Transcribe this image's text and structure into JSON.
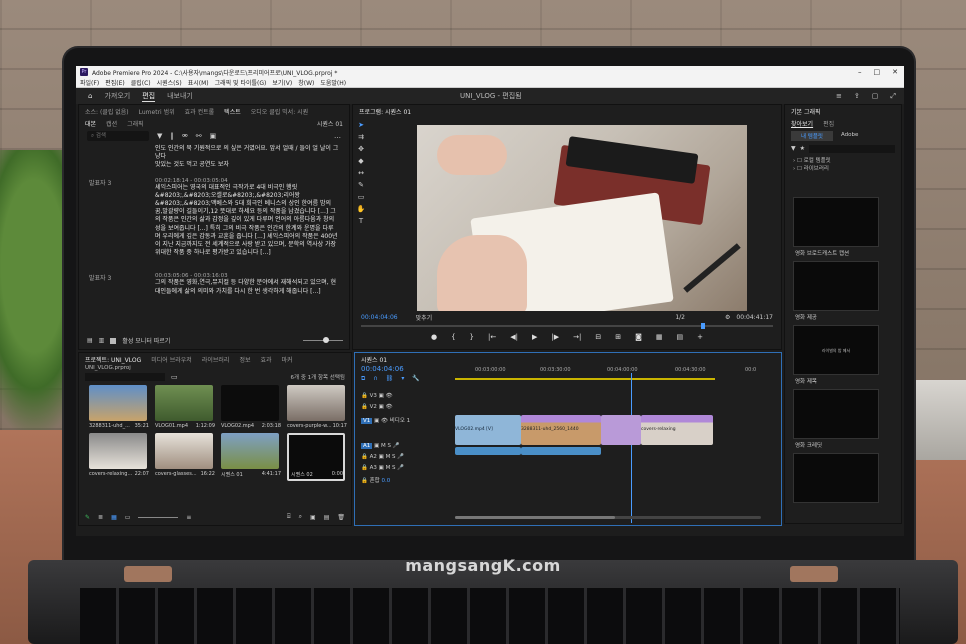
{
  "watermark": "mangsangK.com",
  "app": {
    "title": "Adobe Premiere Pro 2024 - C:\\사용자\\mangs\\다운로드\\프리미어프로\\UNI_VLOG.prproj *",
    "menu": [
      "파일(F)",
      "편집(E)",
      "클립(C)",
      "시퀀스(S)",
      "표시(M)",
      "그래픽 및 타이틀(G)",
      "보기(V)",
      "창(W)",
      "도움말(H)"
    ],
    "workspace_tabs": [
      "가져오기",
      "편집",
      "내보내기"
    ],
    "active_workspace": "편집",
    "project_name": "UNI_VLOG - 편집됨"
  },
  "text_panel": {
    "tabs": [
      "소스: (클립 없음)",
      "Lumetri 범위",
      "효과 컨트롤",
      "텍스트",
      "오디오 클립 믹서: 시퀀"
    ],
    "subtabs": [
      "대본",
      "캡션",
      "그래픽"
    ],
    "sequence": "시퀀스 01",
    "search_placeholder": "검색",
    "top_line1": "인도 인간의 북 기원적으로 의 싶은 거였어요. 앞서 얼때 / 들이 얼 날이 그냥다",
    "top_line2": "맛있는 것도 먹고 공연도 보자",
    "entries": [
      {
        "speaker": "발표자 3",
        "time": "00:02:18:14 - 00:03:05:04",
        "text": "셰익스피어는 영국의 대표적인 극작가로 4대 비극인 햄릿&#8203;,&#8203;오셀로&#8203;,&#8203;리어왕&#8203;,&#8203;맥베스와 5대 희극인 베니스의 상인 한여름 밤의 꿈,말괄량이 길들이기,12 뜻대로 하세요 등의 작품을 남겼습니다 [...] 그의 작품은 인간의 삶과 감정을 깊이 있게 다루며 언어의 아름다움과 창의성을 보여줍니다 [...] 특히 그의 비극 작품은 인간의 한계와 운명을 다루며 우리에게 깊은 감동과 교훈을 줍니다 [...] 셰익스피어의 작품은 400년이 지난 지금까지도 전 세계적으로 사랑 받고 있으며, 문학의 역사상 가장 위대한 작품 중 하나로 평가받고 있습니다 [...]"
      },
      {
        "speaker": "발표자 3",
        "time": "00:03:05:06 - 00:03:16:03",
        "text": "그의 작품은 영화,연극,뮤지컬 등 다양한 분야에서 재해석되고 있으며, 현대인들에게 삶의 의미와 가치를 다시 한 번 생각하게 해줍니다 [...]"
      }
    ],
    "monitor_label": "활성 모니터 따르기"
  },
  "program": {
    "tab": "프로그램: 시퀀스 01",
    "timecode_left": "00:04:04:06",
    "fit": "맞추기",
    "quality": "1/2",
    "timecode_right": "00:04:41:17"
  },
  "project": {
    "tabs": [
      "프로젝트: UNI_VLOG",
      "미디어 브라우저",
      "라이브러리",
      "정보",
      "효과",
      "마커"
    ],
    "file": "UNI_VLOG.prproj",
    "count": "6개 중 1개 항목 선택됨",
    "items": [
      {
        "name": "3288311-uhd_...",
        "dur": "35:21"
      },
      {
        "name": "VLOG01.mp4",
        "dur": "1:12:09"
      },
      {
        "name": "VLOG02.mp4",
        "dur": "2:03:18"
      },
      {
        "name": "covers-purple-w...",
        "dur": "10:17"
      },
      {
        "name": "covers-relaxing...",
        "dur": "22:07"
      },
      {
        "name": "covers-glasses...",
        "dur": "16:22"
      },
      {
        "name": "시퀀스 01",
        "dur": "4:41:17"
      },
      {
        "name": "시퀀스 02",
        "dur": "0:00"
      }
    ]
  },
  "timeline": {
    "tab": "시퀀스 01",
    "timecode": "00:04:04:06",
    "ruler": [
      "00:03:00:00",
      "00:03:30:00",
      "00:04:00:00",
      "00:04:30:00",
      "00:0"
    ],
    "tracks": [
      "V3",
      "V2",
      "V1",
      "A1",
      "A2",
      "A3"
    ],
    "v1_label": "비디오 1",
    "mix_label": "혼합",
    "mix_value": "0.0",
    "clips": [
      "VLOG02.mp4 [V]",
      "3288311-uhd_2560_1440",
      "covers-relaxing"
    ]
  },
  "graphics": {
    "title": "기본 그래픽",
    "tabs": [
      "찾아보기",
      "편집"
    ],
    "my_templates": "내 템플릿",
    "adobe": "Adobe",
    "tree": [
      "로컬 템플릿",
      "라이브러리"
    ],
    "templates": [
      {
        "label": "영화 브로드캐스트 캡션",
        "inner": ""
      },
      {
        "label": "영화 제공",
        "inner": ""
      },
      {
        "label": "영화 제목",
        "inner": "라이벌의 밤 메서"
      },
      {
        "label": "영화 크레딧",
        "inner": ""
      },
      {
        "label": "",
        "inner": ""
      }
    ]
  }
}
